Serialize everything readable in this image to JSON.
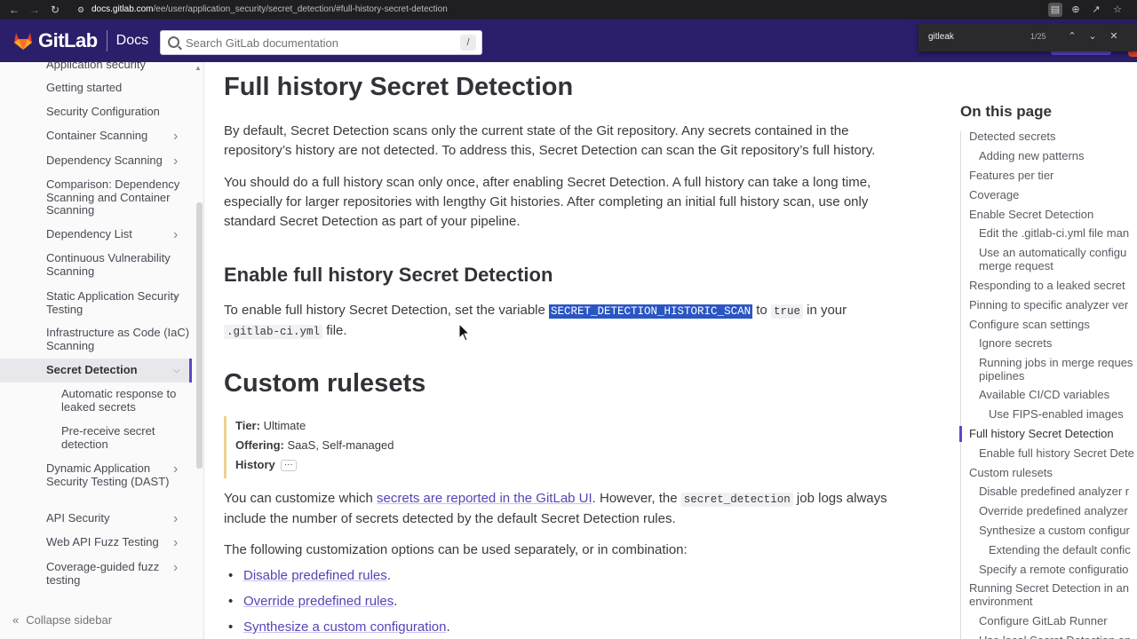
{
  "browser": {
    "url_domain": "docs.gitlab.com",
    "url_path": "/ee/user/application_security/secret_detection/#full-history-secret-detection",
    "find": {
      "query": "gitleak",
      "count": "1/25"
    }
  },
  "header": {
    "brand": "GitLab",
    "section": "Docs",
    "search_placeholder": "Search GitLab documentation",
    "search_shortcut": "/"
  },
  "sidebar": {
    "items": [
      {
        "label": "Application security",
        "chevron": false
      },
      {
        "label": "Getting started",
        "chevron": false
      },
      {
        "label": "Security Configuration",
        "chevron": false
      },
      {
        "label": "Container Scanning",
        "chevron": true
      },
      {
        "label": "Dependency Scanning",
        "chevron": true
      },
      {
        "label": "Comparison: Dependency Scanning and Container Scanning",
        "chevron": false
      },
      {
        "label": "Dependency List",
        "chevron": true
      },
      {
        "label": "Continuous Vulnerability Scanning",
        "chevron": false
      },
      {
        "label": "Static Application Security Testing",
        "chevron": true
      },
      {
        "label": "Infrastructure as Code (IaC) Scanning",
        "chevron": false
      },
      {
        "label": "Secret Detection",
        "chevron": true,
        "active": true
      },
      {
        "label": "Automatic response to leaked secrets",
        "chevron": false,
        "sub": true
      },
      {
        "label": "Pre-receive secret detection",
        "chevron": false,
        "sub": true
      },
      {
        "label": "Dynamic Application Security Testing (DAST)",
        "chevron": true
      },
      {
        "label": "API Security",
        "chevron": true
      },
      {
        "label": "Web API Fuzz Testing",
        "chevron": true
      },
      {
        "label": "Coverage-guided fuzz testing",
        "chevron": true
      }
    ],
    "collapse_label": "Collapse sidebar"
  },
  "main": {
    "h1_full_history": "Full history Secret Detection",
    "p1": "By default, Secret Detection scans only the current state of the Git repository. Any secrets contained in the repository’s history are not detected. To address this, Secret Detection can scan the Git repository’s full history.",
    "p2": "You should do a full history scan only once, after enabling Secret Detection. A full history can take a long time, especially for larger repositories with lengthy Git histories. After completing an initial full history scan, use only standard Secret Detection as part of your pipeline.",
    "h2_enable": "Enable full history Secret Detection",
    "p3_before": "To enable full history Secret Detection, set the variable ",
    "p3_var": "SECRET_DETECTION_HISTORIC_SCAN",
    "p3_mid": " to ",
    "p3_true": "true",
    "p3_after": " in your",
    "p3_file": ".gitlab-ci.yml",
    "p3_end": " file.",
    "h1_custom": "Custom rulesets",
    "tier_label": "Tier:",
    "tier_value": "Ultimate",
    "offering_label": "Offering:",
    "offering_value": "SaaS, Self-managed",
    "history_label": "History",
    "history_dots": "···",
    "p4_before": "You can customize which ",
    "p4_link": "secrets are reported in the GitLab UI",
    "p4_mid": ". However, the ",
    "p4_code": "secret_detection",
    "p4_after": " job logs always include the number of secrets detected by the default Secret Detection rules.",
    "p5": "The following customization options can be used separately, or in combination:",
    "bullets": [
      "Disable predefined rules",
      "Override predefined rules",
      "Synthesize a custom configuration"
    ],
    "bullet_suffix": "."
  },
  "toc": {
    "title": "On this page",
    "items": [
      {
        "label": "Detected secrets",
        "level": 0
      },
      {
        "label": "Adding new patterns",
        "level": 1
      },
      {
        "label": "Features per tier",
        "level": 0
      },
      {
        "label": "Coverage",
        "level": 0
      },
      {
        "label": "Enable Secret Detection",
        "level": 0
      },
      {
        "label": "Edit the .gitlab-ci.yml file man",
        "level": 1
      },
      {
        "label": "Use an automatically configu",
        "label2": "merge request",
        "level": 1
      },
      {
        "label": "Responding to a leaked secret",
        "level": 0
      },
      {
        "label": "Pinning to specific analyzer ver",
        "level": 0
      },
      {
        "label": "Configure scan settings",
        "level": 0
      },
      {
        "label": "Ignore secrets",
        "level": 1
      },
      {
        "label": "Running jobs in merge reques",
        "label2": "pipelines",
        "level": 1
      },
      {
        "label": "Available CI/CD variables",
        "level": 1
      },
      {
        "label": "Use FIPS-enabled images",
        "level": 2
      },
      {
        "label": "Full history Secret Detection",
        "level": 0,
        "active": true
      },
      {
        "label": "Enable full history Secret Dete",
        "level": 1
      },
      {
        "label": "Custom rulesets",
        "level": 0
      },
      {
        "label": "Disable predefined analyzer r",
        "level": 1
      },
      {
        "label": "Override predefined analyzer",
        "level": 1
      },
      {
        "label": "Synthesize a custom configur",
        "level": 1
      },
      {
        "label": "Extending the default confic",
        "level": 2
      },
      {
        "label": "Specify a remote configuratio",
        "level": 1
      },
      {
        "label": "Running Secret Detection in an",
        "label2": "environment",
        "level": 0
      },
      {
        "label": "Configure GitLab Runner",
        "level": 1
      },
      {
        "label": "Use local Secret Detection an",
        "level": 1
      }
    ]
  },
  "colors": {
    "header_bg": "#2b1f6b",
    "accent": "#5c48c7",
    "link": "#5943b5",
    "highlight": "#2a56c4"
  }
}
